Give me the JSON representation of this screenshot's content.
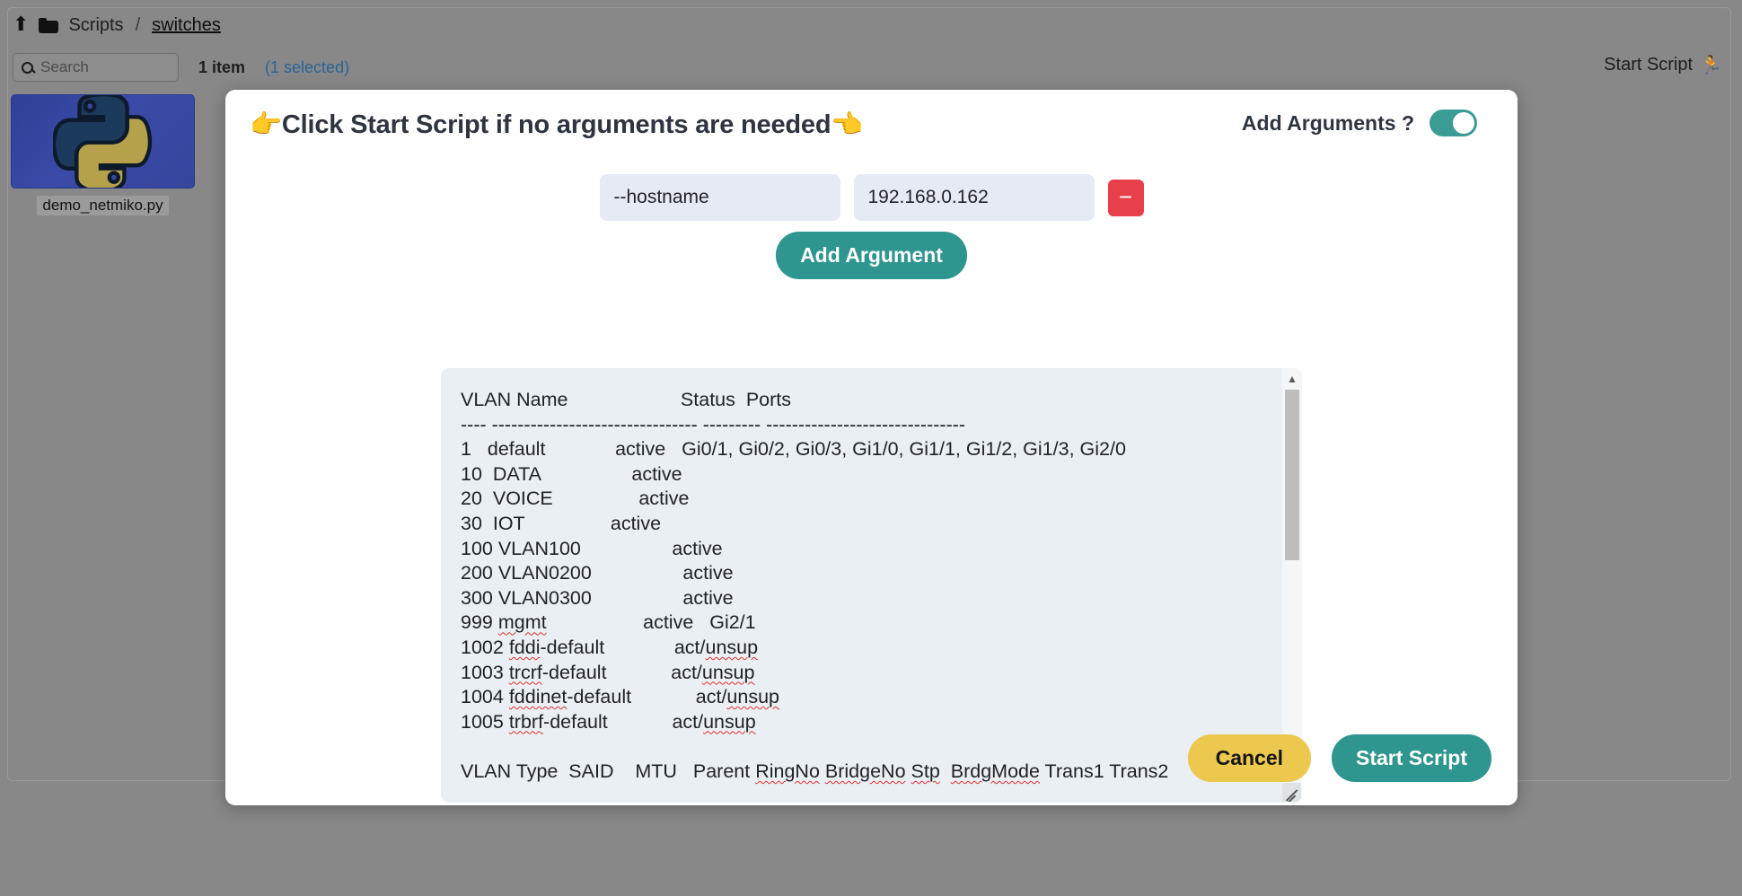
{
  "filemanager": {
    "breadcrumb": {
      "updir_icon": "up-directory-icon",
      "folder_icon": "folder-icon",
      "root": "Scripts",
      "separator": "/",
      "current": "switches"
    },
    "search": {
      "placeholder": "Search",
      "value": "",
      "icon": "search-icon"
    },
    "status": {
      "count": "1 item",
      "selected": "(1 selected)"
    },
    "file": {
      "name": "demo_netmiko.py",
      "icon": "python-file-icon"
    },
    "start_script_menu": {
      "label": "Start Script",
      "icon": "runner-icon"
    }
  },
  "modal": {
    "title": "👉Click Start Script if no arguments are needed👈",
    "toggle": {
      "label": "Add Arguments ?",
      "state": "on"
    },
    "arguments": [
      {
        "key": "--hostname",
        "value": "192.168.0.162",
        "remove_label": "−"
      }
    ],
    "add_argument_label": "Add Argument",
    "output": "VLAN Name                     Status  Ports\n---- -------------------------------- --------- -------------------------------\n1   default             active   Gi0/1, Gi0/2, Gi0/3, Gi1/0, Gi1/1, Gi1/2, Gi1/3, Gi2/0\n10  DATA                 active\n20  VOICE                active\n30  IOT                active\n100 VLAN100                 active\n200 VLAN0200                 active\n300 VLAN0300                 active\n999 mgmt                  active   Gi2/1\n1002 fddi-default             act/unsup\n1003 trcrf-default            act/unsup\n1004 fddinet-default            act/unsup\n1005 trbrf-default            act/unsup\n\nVLAN Type  SAID    MTU   Parent RingNo BridgeNo Stp  BrdgMode Trans1 Trans2",
    "scrollbar": {
      "up_icon": "▲",
      "down_icon": "▼",
      "resize_icon": "resize-grip-icon"
    },
    "footer": {
      "cancel_label": "Cancel",
      "start_label": "Start Script"
    }
  },
  "colors": {
    "teal": "#2f968f",
    "yellow": "#edc84f",
    "red": "#e8404a",
    "input_bg": "#e6eaf5",
    "output_bg": "#eaeff3",
    "link_blue": "#2a6496"
  }
}
